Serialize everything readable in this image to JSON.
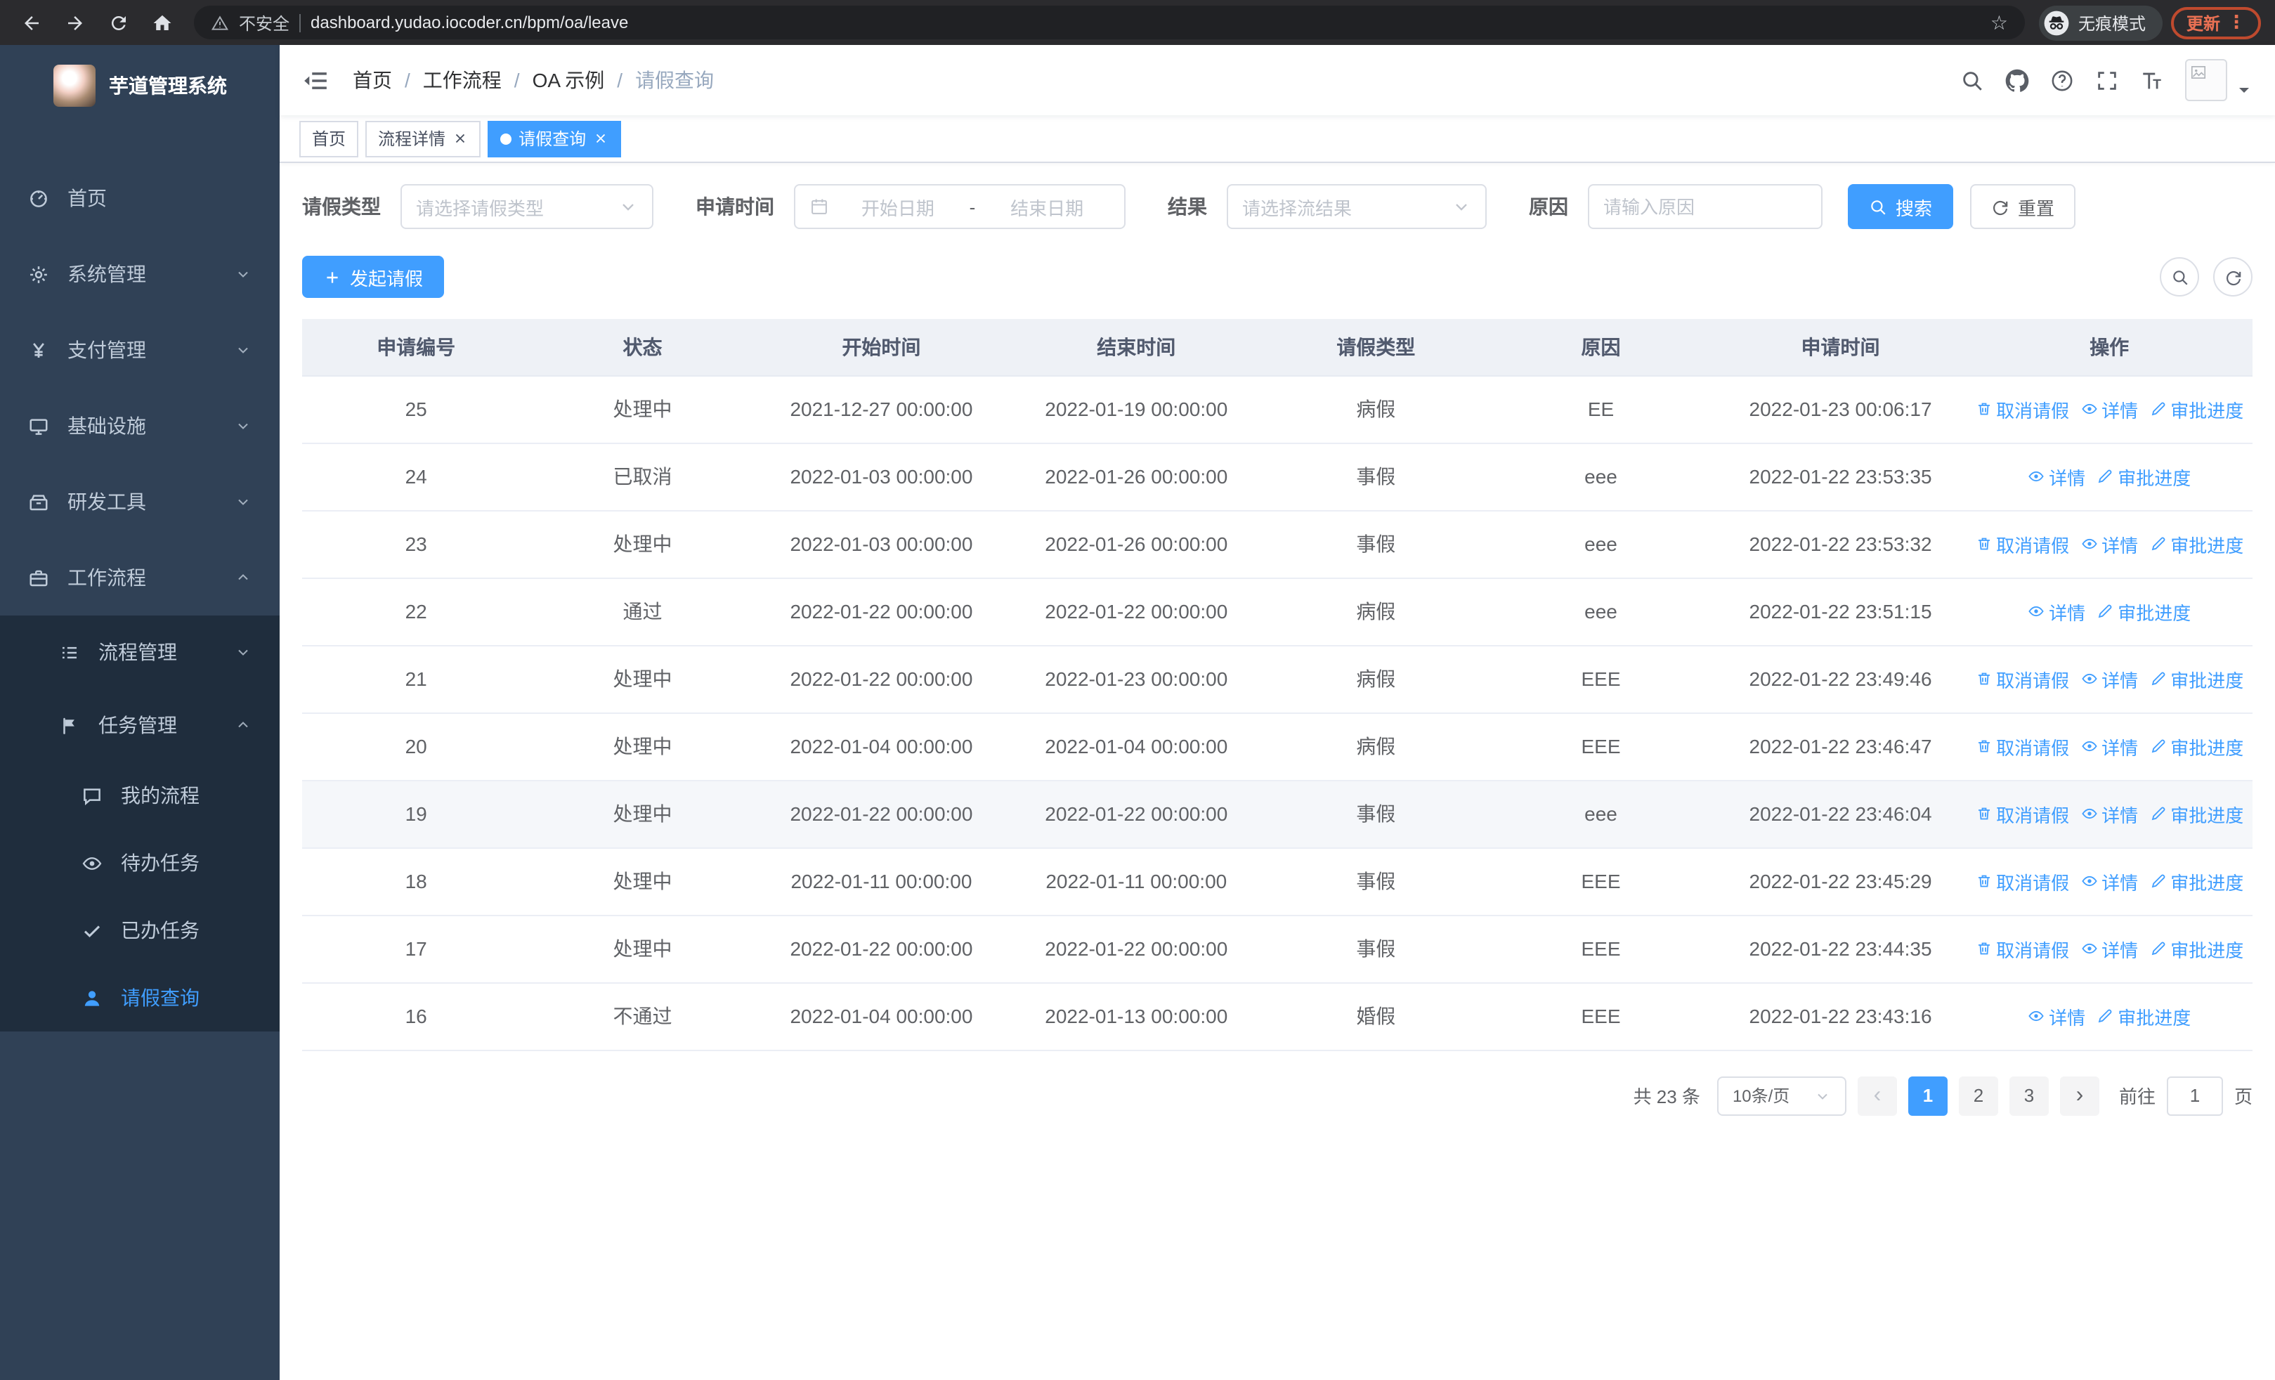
{
  "browser": {
    "security_label": "不安全",
    "url": "dashboard.yudao.iocoder.cn/bpm/oa/leave",
    "incognito_label": "无痕模式",
    "update_label": "更新"
  },
  "sidebar": {
    "logo_title": "芋道管理系统",
    "menu": [
      {
        "key": "home",
        "label": "首页",
        "icon": "dashboard-icon"
      },
      {
        "key": "system-management",
        "label": "系统管理",
        "icon": "gear-icon",
        "chevron": "down"
      },
      {
        "key": "payment-management",
        "label": "支付管理",
        "icon": "yen-icon",
        "chevron": "down"
      },
      {
        "key": "infrastructure",
        "label": "基础设施",
        "icon": "monitor-icon",
        "chevron": "down"
      },
      {
        "key": "dev-tools",
        "label": "研发工具",
        "icon": "toolbox-icon",
        "chevron": "down"
      },
      {
        "key": "workflow",
        "label": "工作流程",
        "icon": "briefcase-icon",
        "chevron": "up",
        "children": [
          {
            "key": "process-management",
            "label": "流程管理",
            "icon": "list-icon",
            "chevron": "down"
          },
          {
            "key": "task-management",
            "label": "任务管理",
            "icon": "flag-icon",
            "chevron": "up",
            "children": [
              {
                "key": "my-process",
                "label": "我的流程",
                "icon": "chat-icon"
              },
              {
                "key": "todo-tasks",
                "label": "待办任务",
                "icon": "eye-icon"
              },
              {
                "key": "done-tasks",
                "label": "已办任务",
                "icon": "check-icon"
              },
              {
                "key": "leave-query",
                "label": "请假查询",
                "icon": "user-icon",
                "active": true
              }
            ]
          }
        ]
      }
    ]
  },
  "header": {
    "breadcrumb": [
      "首页",
      "工作流程",
      "OA 示例",
      "请假查询"
    ]
  },
  "tabs": [
    {
      "key": "home",
      "label": "首页",
      "closable": false,
      "active": false
    },
    {
      "key": "process-detail",
      "label": "流程详情",
      "closable": true,
      "active": false
    },
    {
      "key": "leave-query",
      "label": "请假查询",
      "closable": true,
      "active": true
    }
  ],
  "filters": {
    "leave_type_label": "请假类型",
    "leave_type_placeholder": "请选择请假类型",
    "apply_time_label": "申请时间",
    "start_date_placeholder": "开始日期",
    "range_separator": "-",
    "end_date_placeholder": "结束日期",
    "result_label": "结果",
    "result_placeholder": "请选择流结果",
    "reason_label": "原因",
    "reason_placeholder": "请输入原因",
    "search_label": "搜索",
    "reset_label": "重置"
  },
  "toolbar": {
    "create_label": "发起请假"
  },
  "table": {
    "columns": [
      "申请编号",
      "状态",
      "开始时间",
      "结束时间",
      "请假类型",
      "原因",
      "申请时间",
      "操作"
    ],
    "action_defs": {
      "cancel": {
        "label": "取消请假",
        "icon": "trash-icon"
      },
      "detail": {
        "label": "详情",
        "icon": "eye-icon"
      },
      "progress": {
        "label": "审批进度",
        "icon": "edit-icon"
      }
    },
    "rows": [
      {
        "id": "25",
        "status": "处理中",
        "start": "2021-12-27 00:00:00",
        "end": "2022-01-19 00:00:00",
        "type": "病假",
        "reason": "EE",
        "applied": "2022-01-23 00:06:17",
        "actions": [
          "cancel",
          "detail",
          "progress"
        ]
      },
      {
        "id": "24",
        "status": "已取消",
        "start": "2022-01-03 00:00:00",
        "end": "2022-01-26 00:00:00",
        "type": "事假",
        "reason": "eee",
        "applied": "2022-01-22 23:53:35",
        "actions": [
          "detail",
          "progress"
        ]
      },
      {
        "id": "23",
        "status": "处理中",
        "start": "2022-01-03 00:00:00",
        "end": "2022-01-26 00:00:00",
        "type": "事假",
        "reason": "eee",
        "applied": "2022-01-22 23:53:32",
        "actions": [
          "cancel",
          "detail",
          "progress"
        ]
      },
      {
        "id": "22",
        "status": "通过",
        "start": "2022-01-22 00:00:00",
        "end": "2022-01-22 00:00:00",
        "type": "病假",
        "reason": "eee",
        "applied": "2022-01-22 23:51:15",
        "actions": [
          "detail",
          "progress"
        ]
      },
      {
        "id": "21",
        "status": "处理中",
        "start": "2022-01-22 00:00:00",
        "end": "2022-01-23 00:00:00",
        "type": "病假",
        "reason": "EEE",
        "applied": "2022-01-22 23:49:46",
        "actions": [
          "cancel",
          "detail",
          "progress"
        ]
      },
      {
        "id": "20",
        "status": "处理中",
        "start": "2022-01-04 00:00:00",
        "end": "2022-01-04 00:00:00",
        "type": "病假",
        "reason": "EEE",
        "applied": "2022-01-22 23:46:47",
        "actions": [
          "cancel",
          "detail",
          "progress"
        ]
      },
      {
        "id": "19",
        "status": "处理中",
        "start": "2022-01-22 00:00:00",
        "end": "2022-01-22 00:00:00",
        "type": "事假",
        "reason": "eee",
        "applied": "2022-01-22 23:46:04",
        "actions": [
          "cancel",
          "detail",
          "progress"
        ],
        "highlighted": true
      },
      {
        "id": "18",
        "status": "处理中",
        "start": "2022-01-11 00:00:00",
        "end": "2022-01-11 00:00:00",
        "type": "事假",
        "reason": "EEE",
        "applied": "2022-01-22 23:45:29",
        "actions": [
          "cancel",
          "detail",
          "progress"
        ]
      },
      {
        "id": "17",
        "status": "处理中",
        "start": "2022-01-22 00:00:00",
        "end": "2022-01-22 00:00:00",
        "type": "事假",
        "reason": "EEE",
        "applied": "2022-01-22 23:44:35",
        "actions": [
          "cancel",
          "detail",
          "progress"
        ]
      },
      {
        "id": "16",
        "status": "不通过",
        "start": "2022-01-04 00:00:00",
        "end": "2022-01-13 00:00:00",
        "type": "婚假",
        "reason": "EEE",
        "applied": "2022-01-22 23:43:16",
        "actions": [
          "detail",
          "progress"
        ]
      }
    ]
  },
  "pagination": {
    "total_label": "共 23 条",
    "page_size_label": "10条/页",
    "pages": [
      "1",
      "2",
      "3"
    ],
    "active_page": "1",
    "goto_label": "前往",
    "goto_value": "1",
    "goto_suffix": "页"
  },
  "icons": {
    "browser": [
      "back-icon",
      "forward-icon",
      "reload-icon",
      "home-icon",
      "warning-icon",
      "bookmark-star-icon",
      "incognito-icon",
      "browser-menu-icon"
    ],
    "header": [
      "fold-icon",
      "search-icon",
      "github-icon",
      "question-icon",
      "fullscreen-icon",
      "font-size-icon",
      "broken-image-icon",
      "caret-down-icon"
    ],
    "table_actions": [
      "trash-icon",
      "eye-icon",
      "edit-icon"
    ]
  }
}
